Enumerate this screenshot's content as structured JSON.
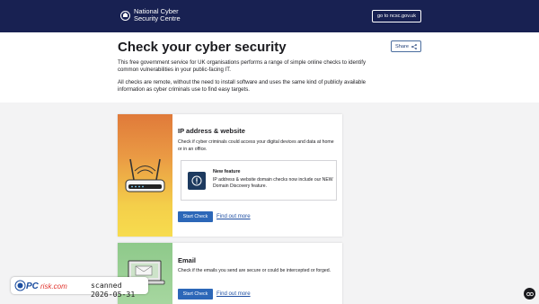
{
  "header": {
    "logo_line1": "National Cyber",
    "logo_line2": "Security Centre",
    "goto_label": "go to ncsc.gov.uk"
  },
  "hero": {
    "title": "Check your cyber security",
    "share_label": "Share",
    "intro_1": "This free government service for UK organisations performs a range of simple online checks to identify common vulnerabilities in your public-facing IT.",
    "intro_2": "All checks are remote, without the need to install software and uses the same kind of publicly available information as cyber criminals use to find easy targets."
  },
  "cards": [
    {
      "title": "IP address & website",
      "description": "Check if cyber criminals could access your digital devices and data at home or in an office.",
      "feature_title": "New feature",
      "feature_text": "IP address & website domain checks now include our NEW Domain Discovery feature.",
      "start_label": "Start Check",
      "find_label": "Find out more"
    },
    {
      "title": "Email",
      "description": "Check if the emails you send are secure or could be intercepted or forged.",
      "start_label": "Start Check",
      "find_label": "Find out more"
    }
  ],
  "watermark": {
    "logo_text": "PCrisk.com",
    "scan_text": "scanned 2026-05-31"
  },
  "colors": {
    "header_bg": "#182152",
    "button_blue": "#2c67b8",
    "link_blue": "#1f4fa3"
  }
}
